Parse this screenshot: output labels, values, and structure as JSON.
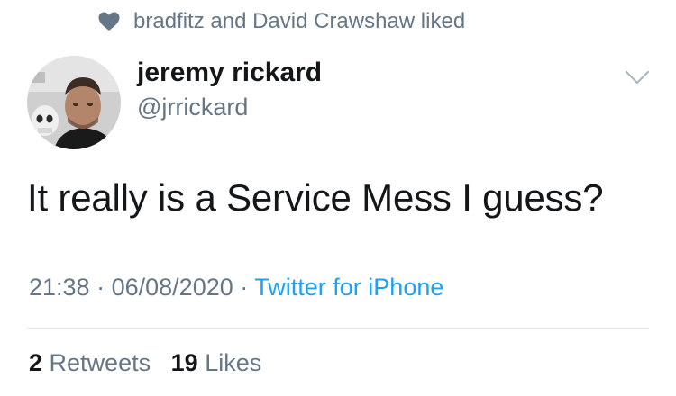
{
  "social_context": {
    "text": "bradfitz and David Crawshaw liked",
    "icon": "heart-icon"
  },
  "author": {
    "display_name": "jeremy rickard",
    "handle": "@jrrickard",
    "avatar": "profile-photo"
  },
  "tweet": {
    "text": "It really is a Service Mess I guess?",
    "time": "21:38",
    "separator": "·",
    "date": "06/08/2020",
    "source": "Twitter for iPhone"
  },
  "stats": {
    "retweets_count": "2",
    "retweets_label": "Retweets",
    "likes_count": "19",
    "likes_label": "Likes"
  },
  "colors": {
    "text_primary": "#14171a",
    "text_secondary": "#657786",
    "link": "#1da1f2",
    "divider": "#e1e8ed"
  }
}
